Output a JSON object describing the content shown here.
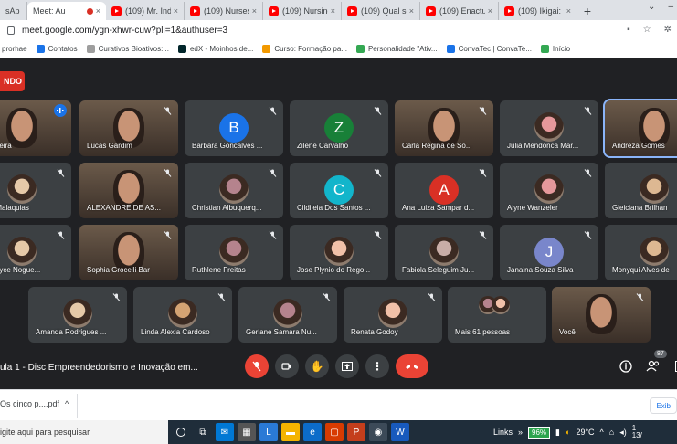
{
  "browser": {
    "tabs": [
      {
        "label": "sAp",
        "type": "plain"
      },
      {
        "label": "Meet: Au",
        "type": "meet",
        "active": true,
        "recording": true
      },
      {
        "label": "(109) Mr. Indi",
        "type": "yt"
      },
      {
        "label": "(109) Nurses",
        "type": "yt"
      },
      {
        "label": "(109) Nursing",
        "type": "yt"
      },
      {
        "label": "(109) Qual se",
        "type": "yt"
      },
      {
        "label": "(109) Enactu",
        "type": "yt"
      },
      {
        "label": "(109) Ikigai: C",
        "type": "yt"
      }
    ],
    "new_tab": "+",
    "url": "meet.google.com/ygn-xhwr-cuw?pli=1&authuser=3",
    "bookmarks": [
      {
        "label": "prorhae",
        "color": "#5f6368"
      },
      {
        "label": "Contatos",
        "color": "#1a73e8"
      },
      {
        "label": "Curativos Bioativos:...",
        "color": "#9e9e9e"
      },
      {
        "label": "edX - Moinhos de...",
        "color": "#02262b"
      },
      {
        "label": "Curso: Formação pa...",
        "color": "#f29900"
      },
      {
        "label": "Personalidade \"Ativ...",
        "color": "#34a853"
      },
      {
        "label": "ConvaTec | ConvaTe...",
        "color": "#1a73e8"
      },
      {
        "label": "Início",
        "color": "#34a853"
      }
    ]
  },
  "meet": {
    "recording_label": "NDO",
    "participants": [
      {
        "name": "ta Pereira",
        "kind": "video",
        "speaking": true
      },
      {
        "name": "Lucas Gardim",
        "kind": "video"
      },
      {
        "name": "Barbara Goncalves ...",
        "kind": "letter",
        "letter": "B",
        "color": "#1a73e8"
      },
      {
        "name": "Zilene Carvalho",
        "kind": "letter",
        "letter": "Z",
        "color": "#188038"
      },
      {
        "name": "Carla Regina de So...",
        "kind": "video"
      },
      {
        "name": "Julia Mendonca Mar...",
        "kind": "photo"
      },
      {
        "name": "Andreza Gomes",
        "kind": "video",
        "highlight": true
      },
      {
        "name": "iane Malaquias",
        "kind": "photo"
      },
      {
        "name": "ALEXANDRE DE AS...",
        "kind": "video"
      },
      {
        "name": "Christian Albuquerq...",
        "kind": "photo"
      },
      {
        "name": "Cildileia Dos Santos ...",
        "kind": "letter",
        "letter": "C",
        "color": "#12b5cb"
      },
      {
        "name": "Ana Luiza Sampar d...",
        "kind": "letter",
        "letter": "A",
        "color": "#d93025"
      },
      {
        "name": "Alyne Wanzeler",
        "kind": "photo"
      },
      {
        "name": "Gleiciana Brilhan",
        "kind": "photo"
      },
      {
        "name": "nin Joyce Nogue...",
        "kind": "photo"
      },
      {
        "name": "Sophia Grocelli Bar",
        "kind": "video"
      },
      {
        "name": "Ruthlene Freitas",
        "kind": "photo"
      },
      {
        "name": "Jose Plynio do Rego...",
        "kind": "photo"
      },
      {
        "name": "Fabiola Seleguim Ju...",
        "kind": "photo"
      },
      {
        "name": "Janaina Souza Silva",
        "kind": "letter",
        "letter": "J",
        "color": "#7986cb"
      },
      {
        "name": "Monyqui Alves de",
        "kind": "photo"
      },
      {
        "name": "Amanda Rodrigues ...",
        "kind": "photo"
      },
      {
        "name": "Linda Alexia Cardoso",
        "kind": "photo"
      },
      {
        "name": "Gerlane Samara Nu...",
        "kind": "photo"
      },
      {
        "name": "Renata Godoy",
        "kind": "photo"
      },
      {
        "name": "Mais 61 pessoas",
        "kind": "more"
      },
      {
        "name": "Você",
        "kind": "video"
      }
    ],
    "meeting_title": "ula 1 - Disc Empreendedorismo e Inovação em...",
    "people_count": "87"
  },
  "download": {
    "file": "Os cinco p....pdf",
    "show_all": "Exib"
  },
  "taskbar": {
    "search_placeholder": "igite aqui para pesquisar",
    "links": "Links",
    "battery": "96%",
    "temp": "29°C",
    "time": "1",
    "date": "13/"
  }
}
